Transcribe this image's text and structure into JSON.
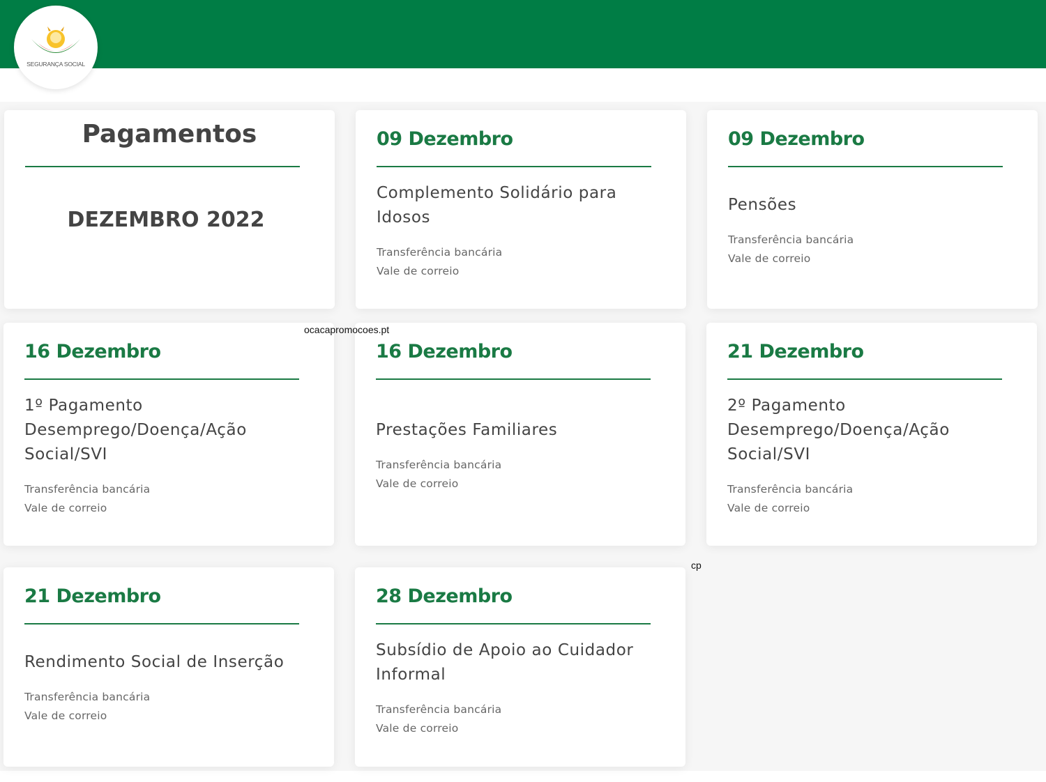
{
  "header": {
    "logo_text": "SEGURANÇA SOCIAL",
    "bar_color": "#007d45"
  },
  "intro": {
    "heading": "Pagamentos",
    "month": "DEZEMBRO 2022"
  },
  "payments": [
    {
      "date": "09 Dezembro",
      "title": "Complemento Solidário para Idosos",
      "methods": [
        "Transferência bancária",
        "Vale de correio"
      ]
    },
    {
      "date": "09 Dezembro",
      "title": "Pensões",
      "methods": [
        "Transferência bancária",
        "Vale de correio"
      ]
    },
    {
      "date": "16 Dezembro",
      "title": "1º Pagamento Desemprego/Doença/Ação Social/SVI",
      "methods": [
        "Transferência bancária",
        "Vale de correio"
      ]
    },
    {
      "date": "16 Dezembro",
      "title": "Prestações Familiares",
      "methods": [
        "Transferência bancária",
        "Vale de correio"
      ]
    },
    {
      "date": "21 Dezembro",
      "title": "2º Pagamento Desemprego/Doença/Ação Social/SVI",
      "methods": [
        "Transferência bancária",
        "Vale de correio"
      ]
    },
    {
      "date": "21 Dezembro",
      "title": "Rendimento Social de Inserção",
      "methods": [
        "Transferência bancária",
        "Vale de correio"
      ]
    },
    {
      "date": "28 Dezembro",
      "title": "Subsídio de Apoio ao Cuidador Informal",
      "methods": [
        "Transferência bancária",
        "Vale de correio"
      ]
    }
  ],
  "watermarks": {
    "site": "ocacapromocoes.pt",
    "short": "cp"
  },
  "colors": {
    "accent": "#1a7a44",
    "text": "#444444",
    "muted": "#666666"
  }
}
